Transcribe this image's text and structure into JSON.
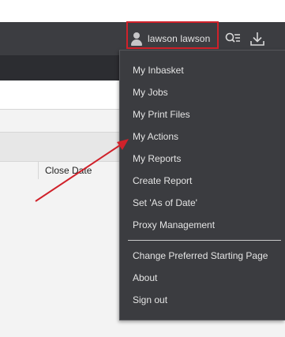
{
  "header": {
    "user_name": "lawson lawson",
    "user_icon": "user-icon",
    "search_icon": "search-list-icon",
    "download_icon": "download-icon"
  },
  "table": {
    "column_header": "Close Date"
  },
  "menu": {
    "items": [
      {
        "label": "My Inbasket"
      },
      {
        "label": "My Jobs"
      },
      {
        "label": "My Print Files"
      },
      {
        "label": "My Actions"
      },
      {
        "label": "My Reports"
      },
      {
        "label": "Create Report"
      },
      {
        "label": "Set 'As of Date'"
      },
      {
        "label": "Proxy Management"
      },
      {
        "label": "Change Preferred Starting Page"
      },
      {
        "label": "About"
      },
      {
        "label": "Sign out"
      }
    ]
  },
  "colors": {
    "header_bg": "#3c3d41",
    "menu_bg": "#3b3c40",
    "highlight_border": "#d0212a",
    "arrow": "#d0212a"
  }
}
